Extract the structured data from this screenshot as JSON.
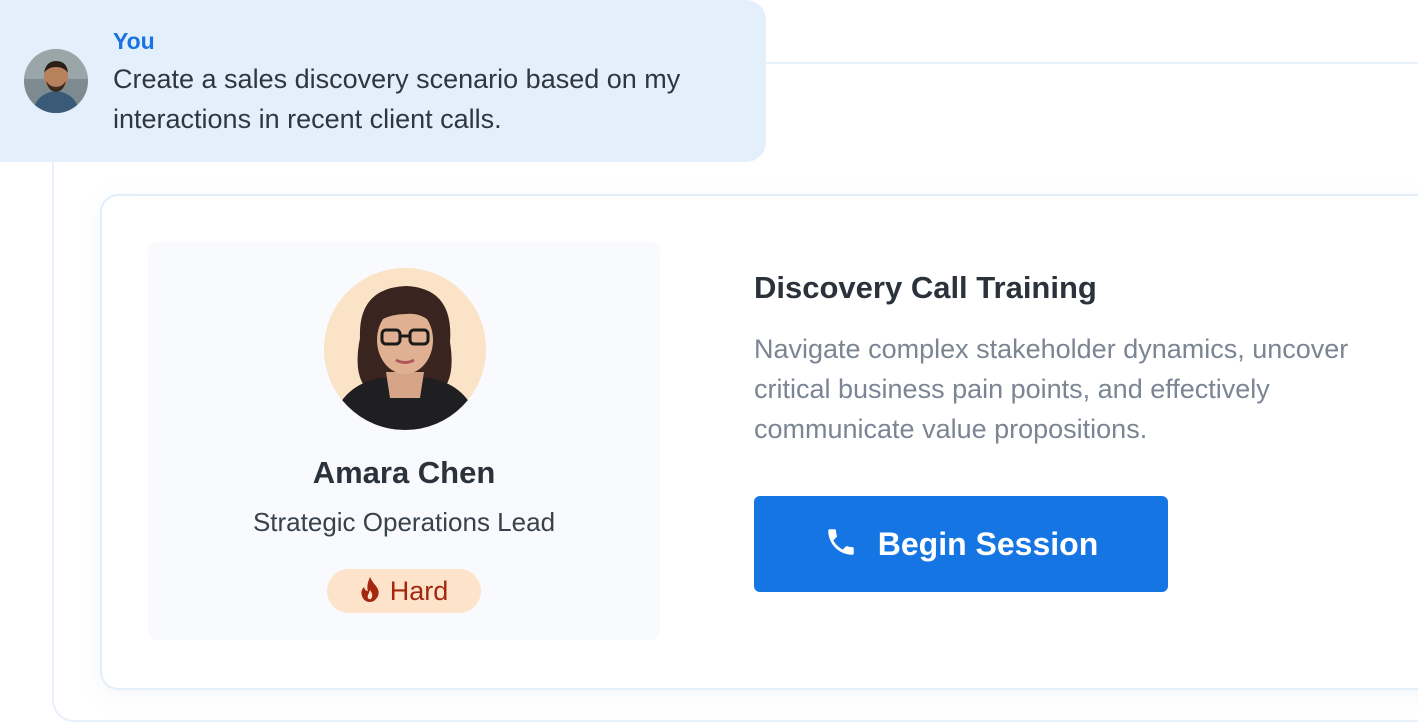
{
  "chat": {
    "author": "You",
    "message": "Create a sales discovery scenario based on my interactions in recent client calls."
  },
  "persona": {
    "name": "Amara Chen",
    "role": "Strategic Operations Lead",
    "difficulty": "Hard",
    "difficulty_icon": "flame-icon"
  },
  "scenario": {
    "title": "Discovery Call Training",
    "description": "Navigate complex stakeholder dynamics, uncover critical business pain points, and effectively communicate value propositions.",
    "action_label": "Begin Session",
    "action_icon": "phone-icon"
  },
  "colors": {
    "accent": "#1576e3",
    "bubble_bg": "#e4effc",
    "badge_bg": "#fde3c9",
    "badge_text": "#a3280f"
  }
}
